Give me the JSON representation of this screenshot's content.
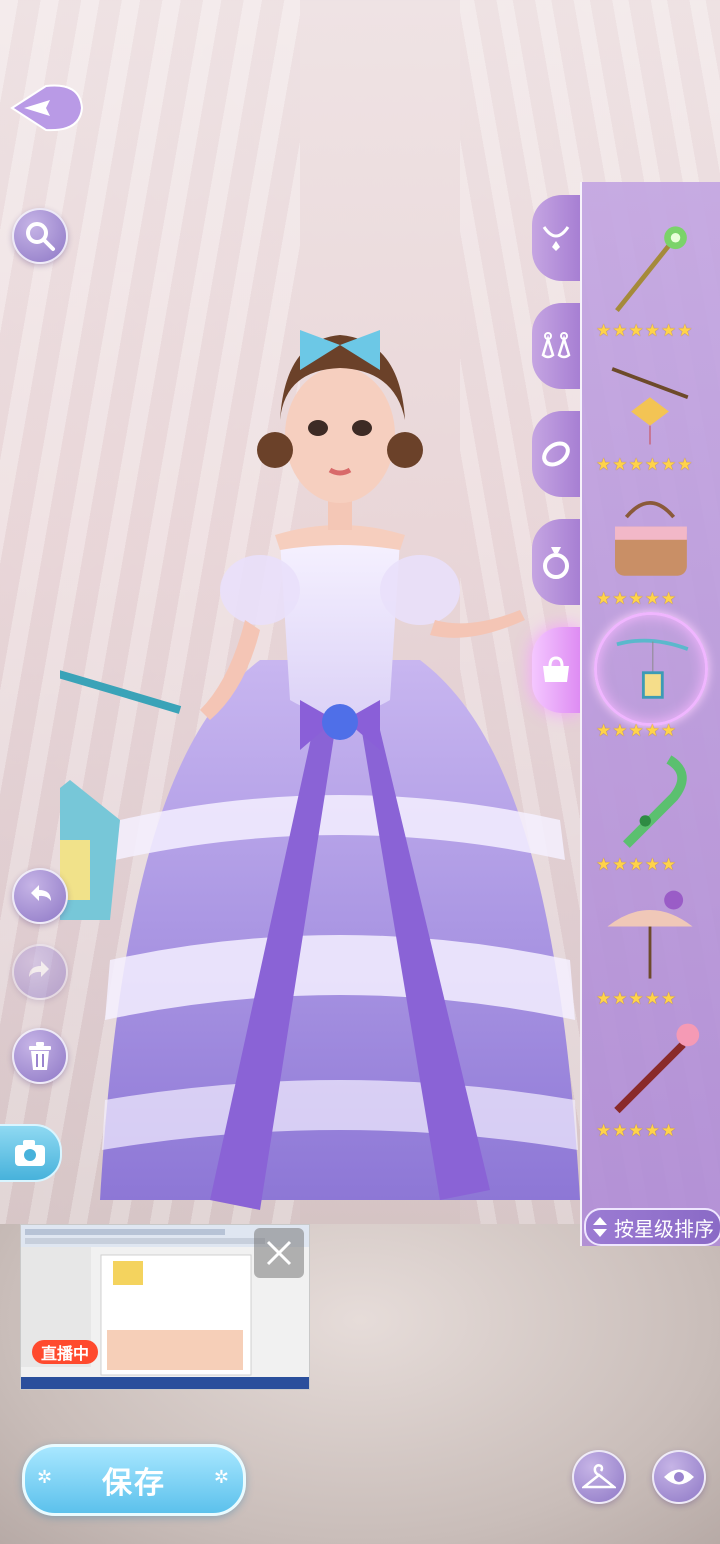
{
  "items": [
    {
      "name": "green-scepter",
      "stars": 6
    },
    {
      "name": "lotus-lantern-staff",
      "stars": 6
    },
    {
      "name": "pink-basket",
      "stars": 5
    },
    {
      "name": "blue-lantern-branch",
      "stars": 5,
      "selected": true
    },
    {
      "name": "green-feather-fan",
      "stars": 5
    },
    {
      "name": "rose-umbrella",
      "stars": 5
    },
    {
      "name": "red-sword",
      "stars": 5
    }
  ],
  "categories": [
    {
      "name": "necklace-icon"
    },
    {
      "name": "earrings-icon"
    },
    {
      "name": "bracelet-icon"
    },
    {
      "name": "ring-icon"
    },
    {
      "name": "handbag-icon",
      "active": true
    }
  ],
  "sort_button": {
    "label": "按星级排序"
  },
  "stream": {
    "live_badge": "直播中"
  },
  "save_button": {
    "label": "保存"
  },
  "colors": {
    "accent_purple": "#a77fd3",
    "save_blue": "#5cc1ec",
    "star_gold": "#ffd34a",
    "live_red": "#ff4a2e"
  }
}
